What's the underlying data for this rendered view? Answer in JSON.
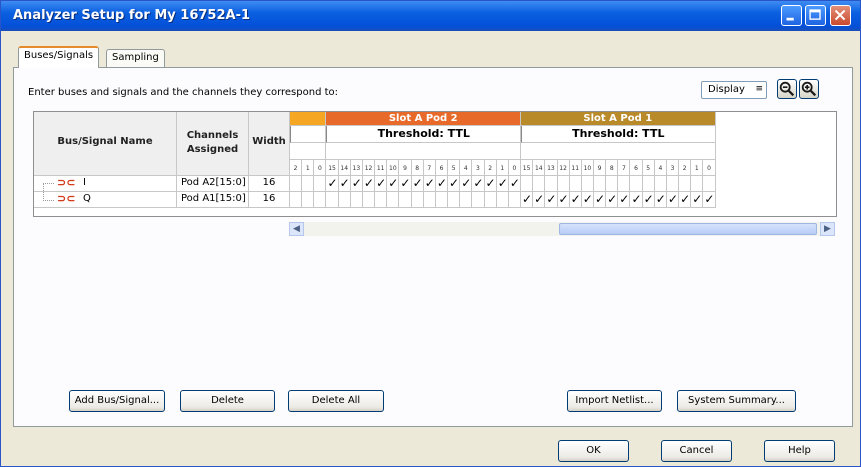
{
  "window": {
    "title": "Analyzer Setup for My 16752A-1"
  },
  "tabs": [
    {
      "label": "Buses/Signals",
      "active": true
    },
    {
      "label": "Sampling",
      "active": false
    }
  ],
  "instructions": "Enter buses and signals and the channels they correspond to:",
  "display_select": {
    "value": "Display"
  },
  "grid": {
    "columns": {
      "name": "Bus/Signal Name",
      "channels": "Channels Assigned",
      "width": "Width"
    },
    "pods": [
      {
        "label": "",
        "threshold": "",
        "bits": [
          "2",
          "1",
          "0"
        ],
        "color": "#F5A623"
      },
      {
        "label": "Slot A Pod 2",
        "threshold": "Threshold: TTL",
        "bits": [
          "15",
          "14",
          "13",
          "12",
          "11",
          "10",
          "9",
          "8",
          "7",
          "6",
          "5",
          "4",
          "3",
          "2",
          "1",
          "0"
        ],
        "color": "#E86A2A"
      },
      {
        "label": "Slot A Pod 1",
        "threshold": "Threshold: TTL",
        "bits": [
          "15",
          "14",
          "13",
          "12",
          "11",
          "10",
          "9",
          "8",
          "7",
          "6",
          "5",
          "4",
          "3",
          "2",
          "1",
          "0"
        ],
        "color": "#B98A2A"
      }
    ],
    "rows": [
      {
        "name": "I",
        "channels": "Pod A2[15:0]",
        "width": "16",
        "pod": 1
      },
      {
        "name": "Q",
        "channels": "Pod A1[15:0]",
        "width": "16",
        "pod": 2
      }
    ],
    "check_glyph": "✓"
  },
  "buttons": {
    "add": "Add Bus/Signal...",
    "delete": "Delete",
    "delete_all": "Delete All",
    "import": "Import Netlist...",
    "summary": "System Summary...",
    "ok": "OK",
    "cancel": "Cancel",
    "help": "Help"
  }
}
